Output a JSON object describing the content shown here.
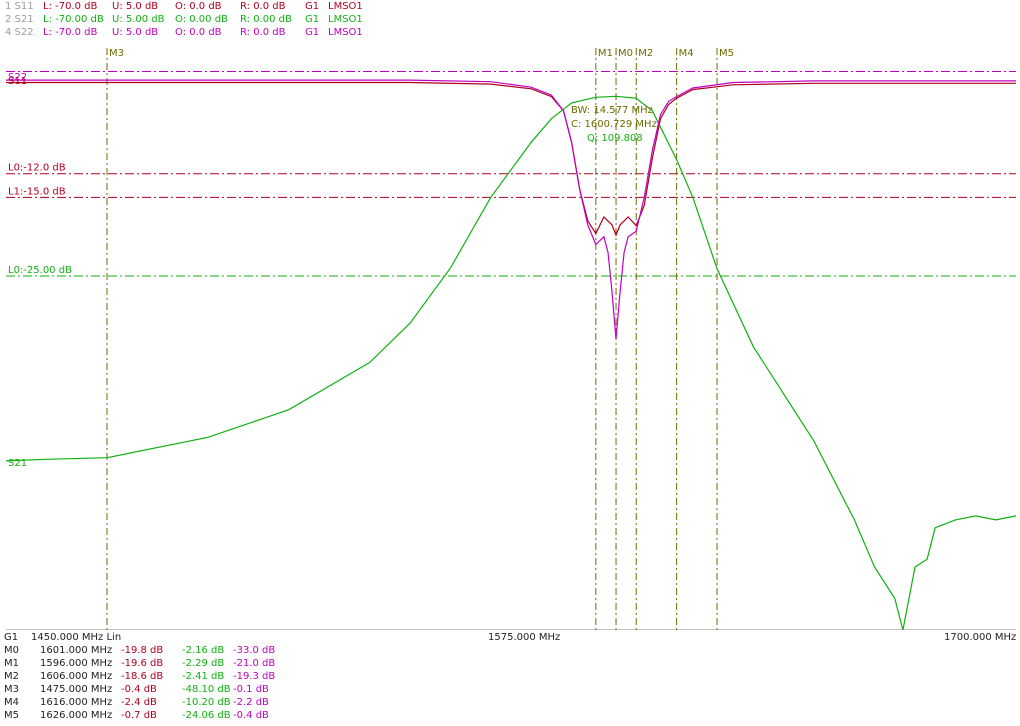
{
  "header": {
    "rows": [
      {
        "id": "1 S11",
        "L": "L: -70.0 dB",
        "U": "U:  5.0 dB",
        "O": "O:  0.0 dB",
        "R": "R:  0.0 dB",
        "G": "G1",
        "mode": "LMSO1",
        "color": "#b00020"
      },
      {
        "id": "2 S21",
        "L": "L: -70.00 dB",
        "U": "U:  5.00 dB",
        "O": "O:  0.00 dB",
        "R": "R:  0.00 dB",
        "G": "G1",
        "mode": "LMSO1",
        "color": "#10b010"
      },
      {
        "id": "4 S22",
        "L": "L: -70.0 dB",
        "U": "U:  5.0 dB",
        "O": "O:  0.0 dB",
        "R": "R:  0.0 dB",
        "G": "G1",
        "mode": "LMSO1",
        "color": "#c000c0"
      }
    ]
  },
  "footer": {
    "axis": {
      "grp": "G1",
      "start": "1450.000 MHz Lin",
      "center": "1575.000 MHz",
      "stop": "1700.000 MHz"
    },
    "markers": [
      {
        "name": "M0",
        "freq": "1601.000 MHz",
        "s11": "-19.8 dB",
        "s21": "-2.16 dB",
        "s22": "-33.0 dB"
      },
      {
        "name": "M1",
        "freq": "1596.000 MHz",
        "s11": "-19.6 dB",
        "s21": "-2.29 dB",
        "s22": "-21.0 dB"
      },
      {
        "name": "M2",
        "freq": "1606.000 MHz",
        "s11": "-18.6 dB",
        "s21": "-2.41 dB",
        "s22": "-19.3 dB"
      },
      {
        "name": "M3",
        "freq": "1475.000 MHz",
        "s11": "-0.4 dB",
        "s21": "-48.10 dB",
        "s22": "-0.1 dB"
      },
      {
        "name": "M4",
        "freq": "1616.000 MHz",
        "s11": "-2.4 dB",
        "s21": "-10.20 dB",
        "s22": "-2.2 dB"
      },
      {
        "name": "M5",
        "freq": "1626.000 MHz",
        "s11": "-0.7 dB",
        "s21": "-24.06 dB",
        "s22": "-0.4 dB"
      }
    ]
  },
  "chart_data": {
    "type": "line",
    "xlim": [
      1450,
      1700
    ],
    "ylim": [
      -70,
      5
    ],
    "colors": {
      "S11": "#b00020",
      "S21": "#10b010",
      "S22": "#c000c0"
    },
    "series": [
      {
        "name": "S11",
        "color": "#b00020",
        "x": [
          1450,
          1550,
          1570,
          1580,
          1585,
          1588,
          1590,
          1592,
          1594,
          1596,
          1598,
          1600,
          1601,
          1602,
          1604,
          1606,
          1608,
          1610,
          1612,
          1614,
          1616,
          1620,
          1630,
          1650,
          1700
        ],
        "y": [
          -0.4,
          -0.4,
          -0.6,
          -1.2,
          -2.2,
          -4,
          -8,
          -14,
          -18,
          -19.6,
          -17.5,
          -18.5,
          -19.8,
          -18.5,
          -17.5,
          -18.6,
          -16,
          -10,
          -5,
          -3.2,
          -2.4,
          -1.3,
          -0.7,
          -0.5,
          -0.5
        ]
      },
      {
        "name": "S21",
        "color": "#10b010",
        "x": [
          1450,
          1460,
          1475,
          1500,
          1520,
          1540,
          1550,
          1560,
          1570,
          1580,
          1585,
          1590,
          1596,
          1601,
          1606,
          1610,
          1616,
          1620,
          1626,
          1635,
          1650,
          1660,
          1665,
          1670,
          1672,
          1675,
          1678,
          1680,
          1685,
          1690,
          1695,
          1700
        ],
        "y": [
          -48.5,
          -48.3,
          -48.1,
          -45.5,
          -42,
          -36,
          -31,
          -24,
          -15,
          -8,
          -5,
          -3,
          -2.29,
          -2.16,
          -2.41,
          -4,
          -10.2,
          -15,
          -24.06,
          -34,
          -46,
          -56,
          -62,
          -66,
          -70,
          -62,
          -61,
          -57,
          -56,
          -55.5,
          -56,
          -55.5
        ]
      },
      {
        "name": "S22",
        "color": "#c000c0",
        "x": [
          1450,
          1550,
          1570,
          1580,
          1585,
          1588,
          1590,
          1592,
          1594,
          1596,
          1598,
          1599,
          1600,
          1601,
          1602,
          1603,
          1604,
          1606,
          1608,
          1610,
          1612,
          1614,
          1616,
          1620,
          1630,
          1650,
          1700
        ],
        "y": [
          -0.1,
          -0.1,
          -0.3,
          -1.0,
          -2.0,
          -4,
          -8,
          -14,
          -18.5,
          -21,
          -20,
          -22,
          -27,
          -33,
          -27,
          -22,
          -20,
          -19.3,
          -15,
          -9,
          -4.5,
          -2.8,
          -2.2,
          -1.1,
          -0.4,
          -0.2,
          -0.2
        ]
      }
    ],
    "limit_lines": [
      {
        "label": "L0:-12.0 dB",
        "value": -12,
        "color": "#b00020"
      },
      {
        "label": "L1:-15.0 dB",
        "value": -15,
        "color": "#b00020"
      },
      {
        "label": "L0:-25.00 dB",
        "value": -25,
        "color": "#10b010"
      }
    ],
    "markers": [
      {
        "label": "M3",
        "x": 1475
      },
      {
        "label": "M1",
        "x": 1596
      },
      {
        "label": "M0",
        "x": 1601
      },
      {
        "label": "M2",
        "x": 1606
      },
      {
        "label": "M4",
        "x": 1616
      },
      {
        "label": "M5",
        "x": 1626
      }
    ],
    "annotation": [
      "BW: 14.577 MHz",
      "C: 1600.729 MHz",
      "Q: 109.808"
    ],
    "trace_labels": [
      "S22",
      "S11",
      "S21"
    ]
  }
}
